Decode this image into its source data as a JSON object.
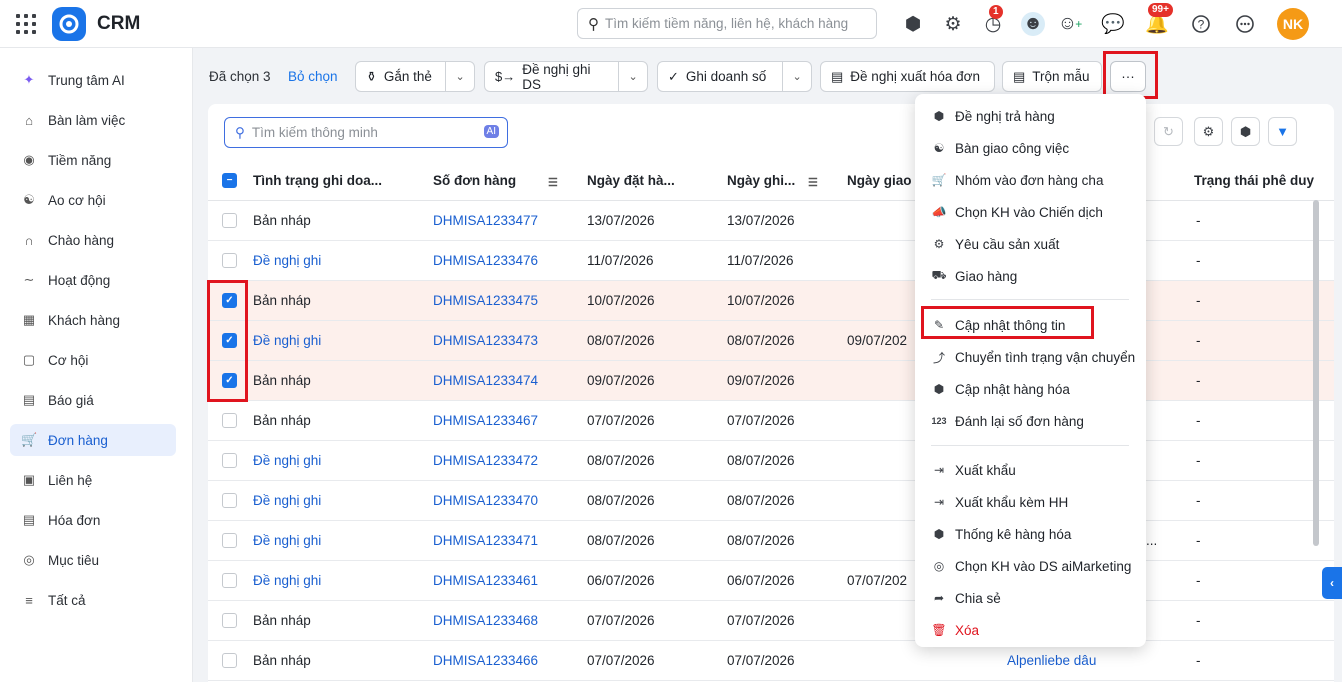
{
  "app": {
    "name": "CRM"
  },
  "header": {
    "search_placeholder": "Tìm kiếm tiềm năng, liên hệ, khách hàng",
    "clock_badge": "1",
    "bell_badge": "99+",
    "avatar_initials": "NK"
  },
  "sidebar": {
    "items": [
      {
        "label": "Trung tâm AI",
        "icon": "sparkle-icon"
      },
      {
        "label": "Bàn làm việc",
        "icon": "home-icon"
      },
      {
        "label": "Tiềm năng",
        "icon": "prospect-icon"
      },
      {
        "label": "Ao cơ hội",
        "icon": "people-icon"
      },
      {
        "label": "Chào hàng",
        "icon": "magnet-icon"
      },
      {
        "label": "Hoạt động",
        "icon": "activity-icon"
      },
      {
        "label": "Khách hàng",
        "icon": "building-icon"
      },
      {
        "label": "Cơ hội",
        "icon": "opportunity-icon"
      },
      {
        "label": "Báo giá",
        "icon": "quote-icon"
      },
      {
        "label": "Đơn hàng",
        "icon": "cart-icon"
      },
      {
        "label": "Liên hệ",
        "icon": "contact-icon"
      },
      {
        "label": "Hóa đơn",
        "icon": "invoice-icon"
      },
      {
        "label": "Mục tiêu",
        "icon": "target-icon"
      },
      {
        "label": "Tất cả",
        "icon": "menu-icon"
      }
    ],
    "active_label": "Đơn hàng"
  },
  "actionbar": {
    "selected_text": "Đã chọn 3",
    "clear_selection": "Bỏ chọn",
    "tag_button": "Gắn thẻ",
    "propose_sales_button": "Đề nghị ghi DS",
    "record_sales_button": "Ghi doanh số",
    "propose_invoice_button": "Đề nghị xuất hóa đơn",
    "mail_merge_button": "Trộn mẫu",
    "more_button": "···"
  },
  "toolbar": {
    "smart_search_placeholder": "Tìm kiếm thông minh",
    "ai_tag": "AI"
  },
  "table": {
    "headers": {
      "status": "Tình trạng ghi doa...",
      "order_no": "Số đơn hàng",
      "order_date": "Ngày đặt hà...",
      "record_date": "Ngày ghi...",
      "delivery_date": "Ngày giao",
      "approval": "Trạng thái phê duy"
    },
    "rows": [
      {
        "status": "Bản nháp",
        "status_link": false,
        "order": "DHMISA1233477",
        "order_date": "13/07/2026",
        "record_date": "13/07/2026",
        "delivery": "",
        "approval": "-",
        "checked": false
      },
      {
        "status": "Đề nghị ghi",
        "status_link": true,
        "order": "DHMISA1233476",
        "order_date": "11/07/2026",
        "record_date": "11/07/2026",
        "delivery": "",
        "approval": "-",
        "checked": false
      },
      {
        "status": "Bản nháp",
        "status_link": false,
        "order": "DHMISA1233475",
        "order_date": "10/07/2026",
        "record_date": "10/07/2026",
        "delivery": "",
        "approval": "-",
        "checked": true
      },
      {
        "status": "Đề nghị ghi",
        "status_link": true,
        "order": "DHMISA1233473",
        "order_date": "08/07/2026",
        "record_date": "08/07/2026",
        "delivery": "09/07/202",
        "approval": "-",
        "checked": true
      },
      {
        "status": "Bản nháp",
        "status_link": false,
        "order": "DHMISA1233474",
        "order_date": "09/07/2026",
        "record_date": "09/07/2026",
        "delivery": "",
        "approval": "-",
        "checked": true
      },
      {
        "status": "Bản nháp",
        "status_link": false,
        "order": "DHMISA1233467",
        "order_date": "07/07/2026",
        "record_date": "07/07/2026",
        "delivery": "",
        "approval": "-",
        "checked": false
      },
      {
        "status": "Đề nghị ghi",
        "status_link": true,
        "order": "DHMISA1233472",
        "order_date": "08/07/2026",
        "record_date": "08/07/2026",
        "delivery": "",
        "approval": "-",
        "checked": false
      },
      {
        "status": "Đề nghị ghi",
        "status_link": true,
        "order": "DHMISA1233470",
        "order_date": "08/07/2026",
        "record_date": "08/07/2026",
        "delivery": "",
        "approval": "-",
        "checked": false
      },
      {
        "status": "Đề nghị ghi",
        "status_link": true,
        "order": "DHMISA1233471",
        "order_date": "08/07/2026",
        "record_date": "08/07/2026",
        "delivery": "",
        "approval": "-",
        "checked": false
      },
      {
        "status": "Đề nghị ghi",
        "status_link": true,
        "order": "DHMISA1233461",
        "order_date": "06/07/2026",
        "record_date": "06/07/2026",
        "delivery": "07/07/202",
        "approval": "-",
        "checked": false
      },
      {
        "status": "Bản nháp",
        "status_link": false,
        "order": "DHMISA1233468",
        "order_date": "07/07/2026",
        "record_date": "07/07/2026",
        "delivery": "",
        "approval": "-",
        "checked": false
      },
      {
        "status": "Bản nháp",
        "status_link": false,
        "order": "DHMISA1233466",
        "order_date": "07/07/2026",
        "record_date": "07/07/2026",
        "delivery": "",
        "approval": "-",
        "checked": false
      }
    ],
    "partial_text_row9": "...",
    "partial_link_row12": "Alpenliebe dâu"
  },
  "more_menu": {
    "items": [
      {
        "label": "Đề nghị trả hàng",
        "icon": "return-box-icon"
      },
      {
        "label": "Bàn giao công việc",
        "icon": "handover-icon"
      },
      {
        "label": "Nhóm vào đơn hàng cha",
        "icon": "cart-group-icon"
      },
      {
        "label": "Chọn KH vào Chiến dịch",
        "icon": "megaphone-icon"
      },
      {
        "label": "Yêu cầu sản xuất",
        "icon": "gear-icon"
      },
      {
        "label": "Giao hàng",
        "icon": "truck-icon"
      },
      {
        "label": "Cập nhật thông tin",
        "icon": "pencil-icon"
      },
      {
        "label": "Chuyển tình trạng vận chuyển",
        "icon": "route-icon"
      },
      {
        "label": "Cập nhật hàng hóa",
        "icon": "box-icon"
      },
      {
        "label": "Đánh lại số đơn hàng",
        "icon": "numbering-icon"
      },
      {
        "label": "Xuất khẩu",
        "icon": "export-icon"
      },
      {
        "label": "Xuất khẩu kèm HH",
        "icon": "export-goods-icon"
      },
      {
        "label": "Thống kê hàng hóa",
        "icon": "stats-box-icon"
      },
      {
        "label": "Chọn KH vào DS aiMarketing",
        "icon": "target-list-icon"
      },
      {
        "label": "Chia sẻ",
        "icon": "share-icon"
      },
      {
        "label": "Xóa",
        "icon": "trash-icon"
      }
    ]
  },
  "colors": {
    "accent": "#1a74e8",
    "highlight_red": "#e0141e",
    "selected_row": "#fdf0ec"
  }
}
